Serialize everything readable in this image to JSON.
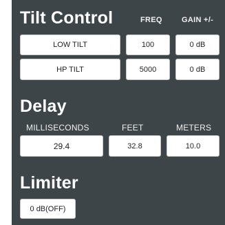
{
  "tilt_control": {
    "heading": "Tilt Control",
    "freq_label": "FREQ",
    "gain_label": "GAIN +/-",
    "rows": [
      {
        "name": "LOW TILT",
        "freq": "100",
        "gain": "0 dB"
      },
      {
        "name": "HP TILT",
        "freq": "5000",
        "gain": "0 dB"
      }
    ]
  },
  "delay": {
    "heading": "Delay",
    "ms_label": "MILLISECONDS",
    "feet_label": "FEET",
    "meters_label": "METERS",
    "ms_value": "29.4",
    "feet_value": "32.8",
    "meters_value": "10.0"
  },
  "limiter": {
    "heading": "Limiter",
    "value": "0 dB(OFF)"
  }
}
